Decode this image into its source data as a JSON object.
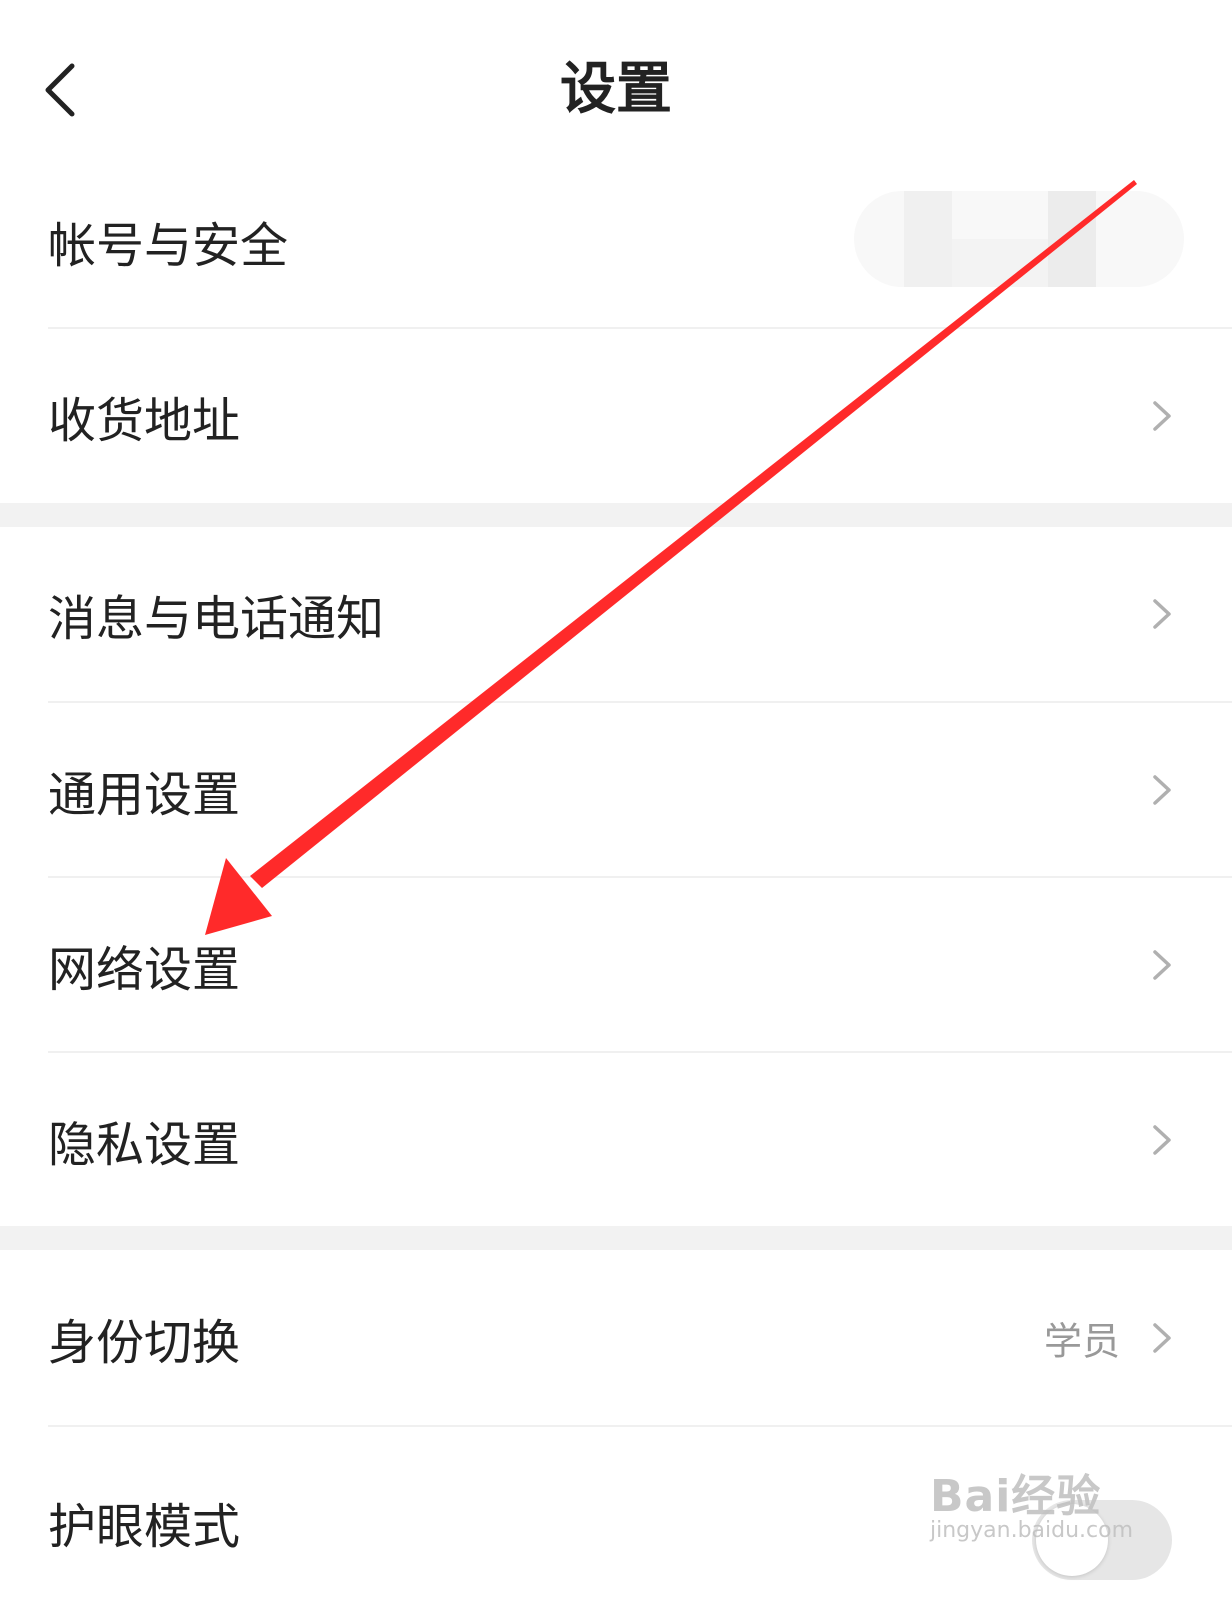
{
  "header": {
    "title": "设置"
  },
  "sections": [
    {
      "items": [
        {
          "label": "帐号与安全"
        },
        {
          "label": "收货地址"
        }
      ]
    },
    {
      "items": [
        {
          "label": "消息与电话通知"
        },
        {
          "label": "通用设置"
        },
        {
          "label": "网络设置"
        },
        {
          "label": "隐私设置"
        }
      ]
    },
    {
      "items": [
        {
          "label": "身份切换",
          "value": "学员"
        },
        {
          "label": "护眼模式"
        }
      ]
    }
  ],
  "eye_mode": {
    "enabled": false
  },
  "watermark": {
    "brand": "Bai经验",
    "url": "jingyan.baidu.com"
  },
  "colors": {
    "annotation_arrow": "#ff2a2a",
    "chevron": "#b0b0b0",
    "value_text": "#999999"
  }
}
